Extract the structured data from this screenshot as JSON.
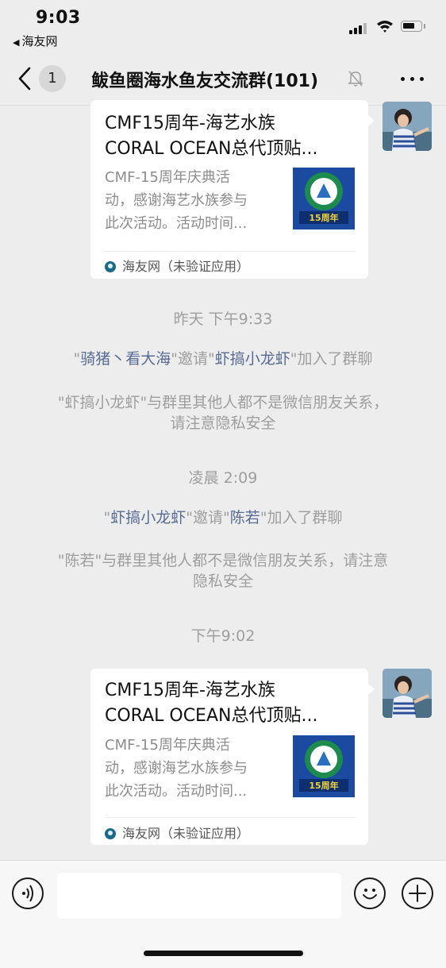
{
  "status_bar": {
    "time": "9:03",
    "back_app": "海友网",
    "back_arrow": "◀"
  },
  "nav": {
    "badge_count": "1",
    "title": "鲅鱼圈海水鱼友交流群(101)",
    "mute_icon": "muted-bell-icon",
    "more_icon": "more-icon"
  },
  "messages": [
    {
      "type": "card",
      "title_line1": "CMF15周年-海艺水族",
      "title_line2": "CORAL OCEAN总代顶贴...",
      "desc_line1": "CMF-15周年庆典活",
      "desc_line2": "动，感谢海艺水族参与",
      "desc_line3": "此次活动。活动时间...",
      "thumb_text": "15周年",
      "source": "海友网（未验证应用）"
    },
    {
      "type": "time",
      "text": "昨天 下午9:33"
    },
    {
      "type": "system",
      "q1": "\"",
      "name1": "骑猪丶看大海",
      "mid": "\"邀请\"",
      "name2": "虾搞小龙虾",
      "tail": "\"加入了群聊"
    },
    {
      "type": "system_notice",
      "line1": "\"虾搞小龙虾\"与群里其他人都不是微信朋友关系，",
      "line2": "请注意隐私安全"
    },
    {
      "type": "time",
      "text": "凌晨 2:09"
    },
    {
      "type": "system",
      "q1": "\"",
      "name1": "虾搞小龙虾",
      "mid": "\"邀请\"",
      "name2": "陈若",
      "tail": "\"加入了群聊"
    },
    {
      "type": "system_notice",
      "line1": "\"陈若\"与群里其他人都不是微信朋友关系，请注意",
      "line2": "隐私安全"
    },
    {
      "type": "time",
      "text": "下午9:02"
    },
    {
      "type": "card",
      "title_line1": "CMF15周年-海艺水族",
      "title_line2": "CORAL OCEAN总代顶贴...",
      "desc_line1": "CMF-15周年庆典活",
      "desc_line2": "动，感谢海艺水族参与",
      "desc_line3": "此次活动。活动时间...",
      "thumb_text": "15周年",
      "source": "海友网（未验证应用）"
    }
  ],
  "input_bar": {
    "voice_icon": "voice-icon",
    "emoji_icon": "emoji-icon",
    "plus_icon": "plus-icon",
    "text_value": ""
  }
}
